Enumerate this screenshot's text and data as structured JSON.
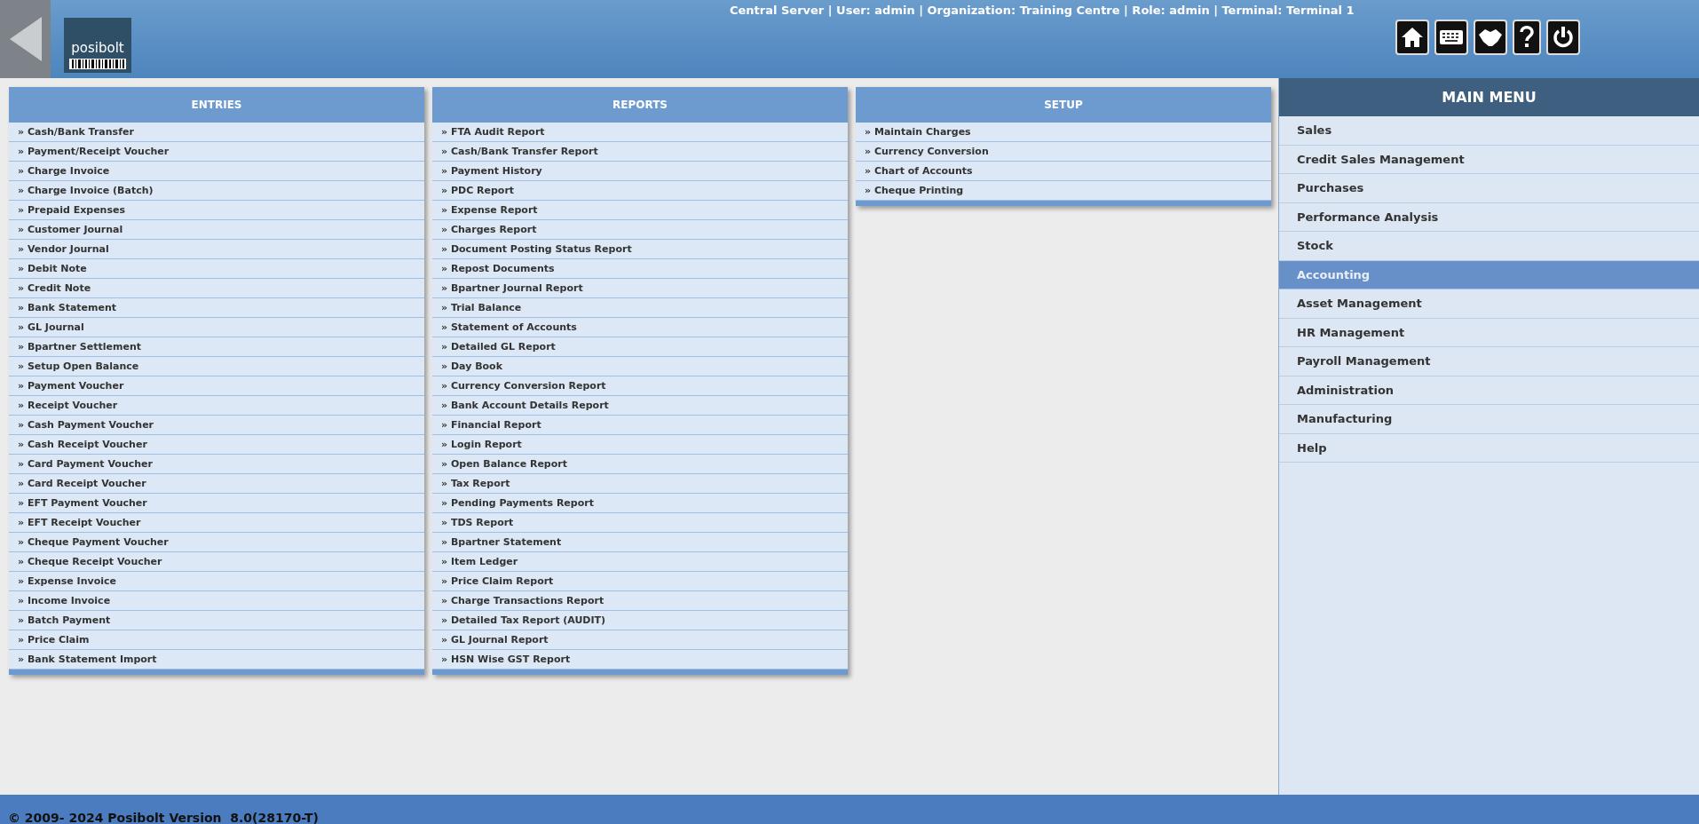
{
  "header": {
    "logo": "posibolt",
    "session": "Central Server | User: admin | Organization: Training Centre | Role: admin | Terminal: Terminal 1"
  },
  "panels": [
    {
      "title": "ENTRIES",
      "items": [
        "» Cash/Bank Transfer",
        "» Payment/Receipt Voucher",
        "» Charge Invoice",
        "» Charge Invoice (Batch)",
        "» Prepaid Expenses",
        "» Customer Journal",
        "» Vendor Journal",
        "» Debit Note",
        "» Credit Note",
        "» Bank Statement",
        "» GL Journal",
        "» Bpartner Settlement",
        "» Setup Open Balance",
        "» Payment Voucher",
        "» Receipt Voucher",
        "» Cash Payment Voucher",
        "» Cash Receipt Voucher",
        "» Card Payment Voucher",
        "» Card Receipt Voucher",
        "» EFT Payment Voucher",
        "» EFT Receipt Voucher",
        "» Cheque Payment Voucher",
        "» Cheque Receipt Voucher",
        "» Expense Invoice",
        "» Income Invoice",
        "» Batch Payment",
        "» Price Claim",
        "» Bank Statement Import"
      ]
    },
    {
      "title": "REPORTS",
      "items": [
        "» FTA Audit Report",
        "» Cash/Bank Transfer Report",
        "» Payment History",
        "» PDC Report",
        "» Expense Report",
        "» Charges Report",
        "» Document Posting Status Report",
        "» Repost Documents",
        "» Bpartner Journal Report",
        "» Trial Balance",
        "» Statement of Accounts",
        "» Detailed GL Report",
        "» Day Book",
        "» Currency Conversion Report",
        "» Bank Account Details Report",
        "» Financial Report",
        "» Login Report",
        "» Open Balance Report",
        "» Tax Report",
        "» Pending Payments Report",
        "» TDS Report",
        "» Bpartner Statement",
        "» Item Ledger",
        "» Price Claim Report",
        "» Charge Transactions Report",
        "» Detailed Tax Report (AUDIT)",
        "» GL Journal Report",
        "» HSN Wise GST Report"
      ]
    },
    {
      "title": "SETUP",
      "items": [
        "» Maintain Charges",
        "» Currency Conversion",
        "» Chart of Accounts",
        "» Cheque Printing"
      ]
    }
  ],
  "main_menu": {
    "title": "MAIN MENU",
    "items": [
      {
        "label": "Sales",
        "selected": false
      },
      {
        "label": "Credit Sales Management",
        "selected": false
      },
      {
        "label": "Purchases",
        "selected": false
      },
      {
        "label": "Performance Analysis",
        "selected": false
      },
      {
        "label": "Stock",
        "selected": false
      },
      {
        "label": "Accounting",
        "selected": true
      },
      {
        "label": "Asset Management",
        "selected": false
      },
      {
        "label": "HR Management",
        "selected": false
      },
      {
        "label": "Payroll Management",
        "selected": false
      },
      {
        "label": "Administration",
        "selected": false
      },
      {
        "label": "Manufacturing",
        "selected": false
      },
      {
        "label": "Help",
        "selected": false
      }
    ]
  },
  "footer": "© 2009- 2024 Posibolt Version  8.0(28170-T)"
}
